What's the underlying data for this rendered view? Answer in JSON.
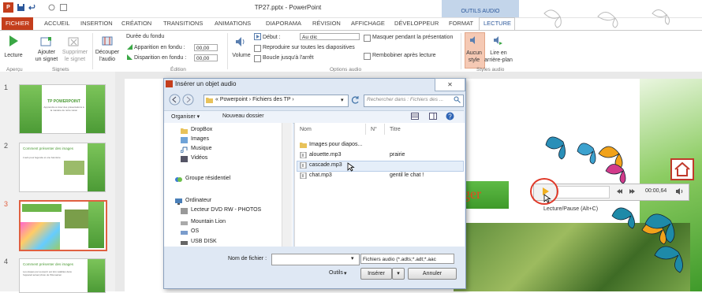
{
  "window": {
    "title": "TP27.pptx - PowerPoint",
    "context_group": "OUTILS AUDIO"
  },
  "tabs": [
    "FICHIER",
    "ACCUEIL",
    "INSERTION",
    "CRÉATION",
    "TRANSITIONS",
    "ANIMATIONS",
    "DIAPORAMA",
    "RÉVISION",
    "AFFICHAGE",
    "DÉVELOPPEUR",
    "FORMAT",
    "LECTURE"
  ],
  "ribbon": {
    "lecture": "Lecture",
    "ajouter_signet": [
      "Ajouter",
      "un signet"
    ],
    "supprimer_signet": [
      "Supprimer",
      "le signet"
    ],
    "decouper": [
      "Découper",
      "l'audio"
    ],
    "duree_fondu": "Durée du fondu",
    "apparition_label": "Apparition en fondu :",
    "apparition_value": "00,00",
    "disparition_label": "Disparition en fondu :",
    "disparition_value": "00,00",
    "volume": "Volume",
    "debut_label": "Début :",
    "debut_value": "Au clic",
    "reproduire": "Reproduire sur toutes les diapositives",
    "boucle": "Boucle jusqu'à l'arrêt",
    "masquer": "Masquer pendant la présentation",
    "rembobiner": "Rembobiner après lecture",
    "aucun_style": [
      "Aucun",
      "style"
    ],
    "lire_arriere": [
      "Lire en",
      "arrière-plan"
    ],
    "groups": [
      "Aperçu",
      "Signets",
      "Édition",
      "Options audio",
      "Styles audio"
    ]
  },
  "slides": [
    {
      "num": "1",
      "title": "TP POWERPOINT",
      "sub": "Apprendre à créer des présentations à la manière de notre vision"
    },
    {
      "num": "2",
      "title": "Comment présenter des images",
      "sub": "L'avis pour légende et une bannière"
    },
    {
      "num": "3",
      "title": "",
      "sub": ""
    },
    {
      "num": "4",
      "title": "Comment présenter des images",
      "sub": "Les étapes par souvenir est très valables dans l'appareil actuel photo de l'Renoarien"
    }
  ],
  "slide": {
    "button_text": "nger",
    "time": "00:00,64",
    "tooltip": "Lecture/Pause (Alt+C)"
  },
  "dialog": {
    "title": "Insérer un objet audio",
    "breadcrumb": "« Powerpoint › Fichiers des TP ›",
    "search_placeholder": "Rechercher dans : Fichiers des ...",
    "organiser": "Organiser ▾",
    "nouveau_dossier": "Nouveau dossier",
    "nav_items": [
      "DropBox",
      "Images",
      "Musique",
      "Vidéos",
      "Groupe résidentiel",
      "Ordinateur",
      "Lecteur DVD RW - PHOTOS",
      "Mountain Lion",
      "OS",
      "USB DISK"
    ],
    "columns": [
      "Nom",
      "N°",
      "Titre"
    ],
    "files": [
      {
        "name": "Images pour diapos...",
        "num": "",
        "title": ""
      },
      {
        "name": "alouette.mp3",
        "num": "",
        "title": "prairie"
      },
      {
        "name": "cascade.mp3",
        "num": "",
        "title": ""
      },
      {
        "name": "chat.mp3",
        "num": "",
        "title": "gentil le chat !"
      }
    ],
    "filename_label": "Nom de fichier :",
    "filetype": "Fichiers audio (*.adts;*.adt;*.aac",
    "outils": "Outils",
    "inserer": "Insérer",
    "annuler": "Annuler"
  }
}
